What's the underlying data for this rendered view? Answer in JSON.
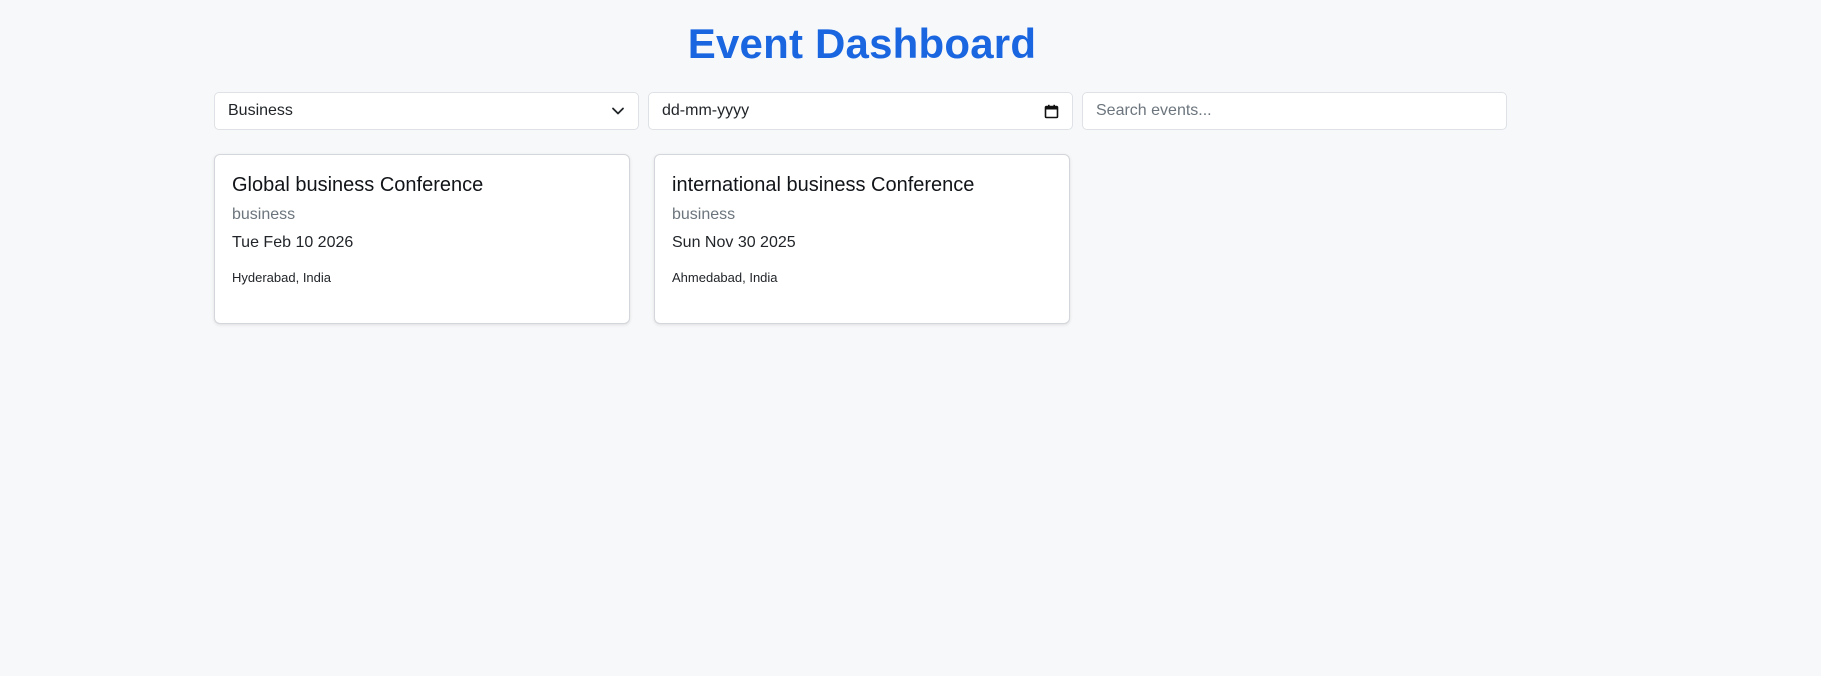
{
  "header": {
    "title": "Event Dashboard"
  },
  "filters": {
    "category_selected": "Business",
    "date_placeholder": "dd-mm-yyyy",
    "search_placeholder": "Search events..."
  },
  "events": [
    {
      "title": "Global business Conference",
      "category": "business",
      "date": "Tue Feb 10 2026",
      "location": "Hyderabad, India"
    },
    {
      "title": "international business Conference",
      "category": "business",
      "date": "Sun Nov 30 2025",
      "location": "Ahmedabad, India"
    }
  ],
  "colors": {
    "accent": "#1a66e0",
    "background": "#f7f8fa",
    "card_border": "#d3d6da",
    "muted_text": "#6c757d"
  },
  "icons": {
    "category_dropdown": "chevron-down-icon",
    "date_picker": "calendar-icon"
  }
}
